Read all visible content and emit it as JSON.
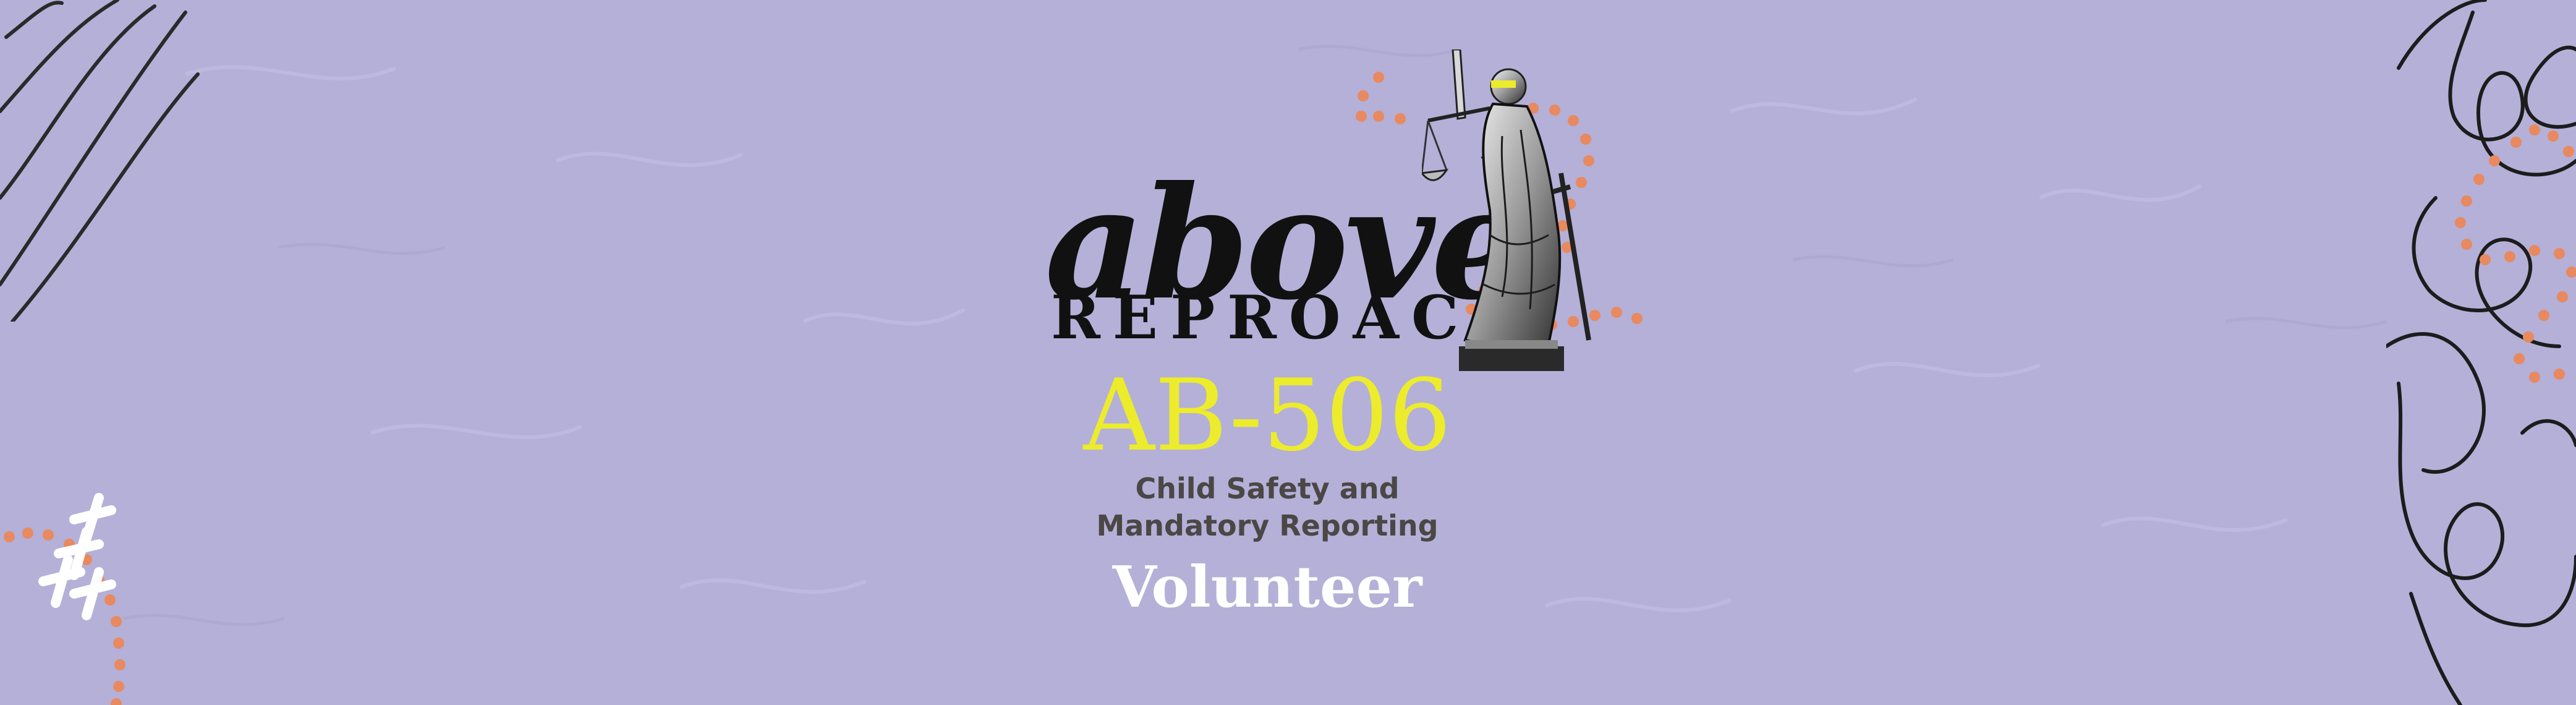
{
  "banner": {
    "brand": {
      "line1": "above",
      "line2": "REPROACH",
      "statue_icon": "lady-justice-statue-icon"
    },
    "course_code": "AB-506",
    "subtitle": {
      "line1": "Child Safety and",
      "line2": "Mandatory Reporting"
    },
    "audience": "Volunteer"
  },
  "colors": {
    "background": "#b4b0d8",
    "brand_text": "#111111",
    "course_code": "#ecec2c",
    "subtitle": "#4a4745",
    "audience": "#ffffff",
    "dots": "#e8895f",
    "lines": "#2a2a2a"
  }
}
